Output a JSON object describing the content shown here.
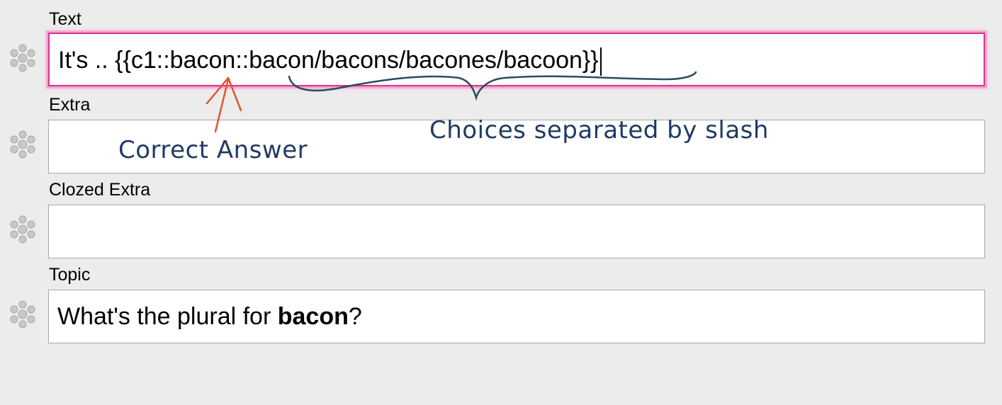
{
  "fields": [
    {
      "label": "Text",
      "value_prefix": "It's .. {{c1::bacon::bacon/bacons/bacones/bacoon}}",
      "focused": true
    },
    {
      "label": "Extra",
      "value_prefix": ""
    },
    {
      "label": "Clozed Extra",
      "value_prefix": ""
    },
    {
      "label": "Topic",
      "value_prefix": "What's the plural for ",
      "value_bold": "bacon",
      "value_suffix": "?"
    }
  ],
  "annotations": {
    "correct_answer": "Correct Answer",
    "choices": "Choices separated by slash"
  },
  "icons": {
    "sticky": "snowflake-sticky-icon"
  },
  "colors": {
    "background": "#ececec",
    "focus_border": "#d9338f",
    "annotation_text": "#1f3b63",
    "arrow": "#e2532d",
    "brace": "#2a4d5c"
  }
}
